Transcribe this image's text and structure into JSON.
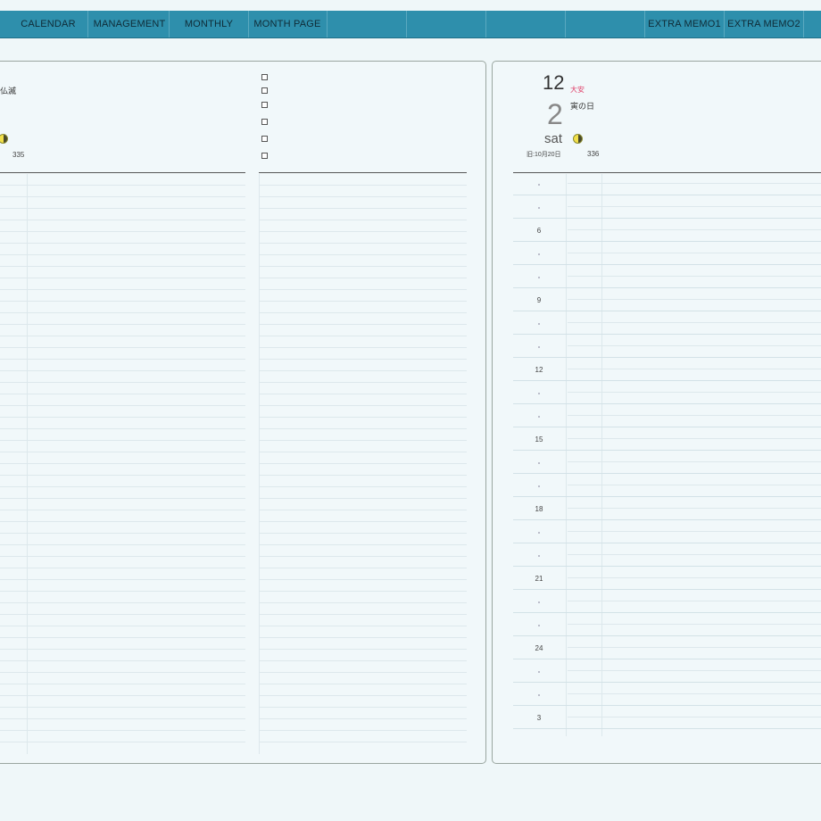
{
  "tabs": [
    {
      "label": "CALENDAR",
      "interactable": true
    },
    {
      "label": "MANAGEMENT",
      "interactable": true
    },
    {
      "label": "MONTHLY",
      "interactable": true
    },
    {
      "label": "MONTH PAGE",
      "interactable": true
    },
    {
      "label": "",
      "interactable": true
    },
    {
      "label": "",
      "interactable": true
    },
    {
      "label": "",
      "interactable": true
    },
    {
      "label": "",
      "interactable": true
    },
    {
      "label": "EXTRA MEMO1",
      "interactable": true
    },
    {
      "label": "EXTRA MEMO2",
      "interactable": true
    }
  ],
  "left_page": {
    "partial_text": "仏滅",
    "day_of_year": "335"
  },
  "right_page": {
    "month": "12",
    "rokuyo": "大安",
    "day_note": "寅の日",
    "date": "2",
    "weekday": "sat",
    "lunar_date": "旧:10月20日",
    "day_of_year": "336",
    "hours": [
      "",
      "",
      "6",
      "",
      "",
      "9",
      "",
      "",
      "12",
      "",
      "",
      "15",
      "",
      "",
      "18",
      "",
      "",
      "21",
      "",
      "",
      "24",
      "",
      "",
      "3"
    ]
  },
  "colors": {
    "tab_bar": "#2e8fac",
    "rokuyo": "#e0406a",
    "background": "#eff7f9"
  }
}
